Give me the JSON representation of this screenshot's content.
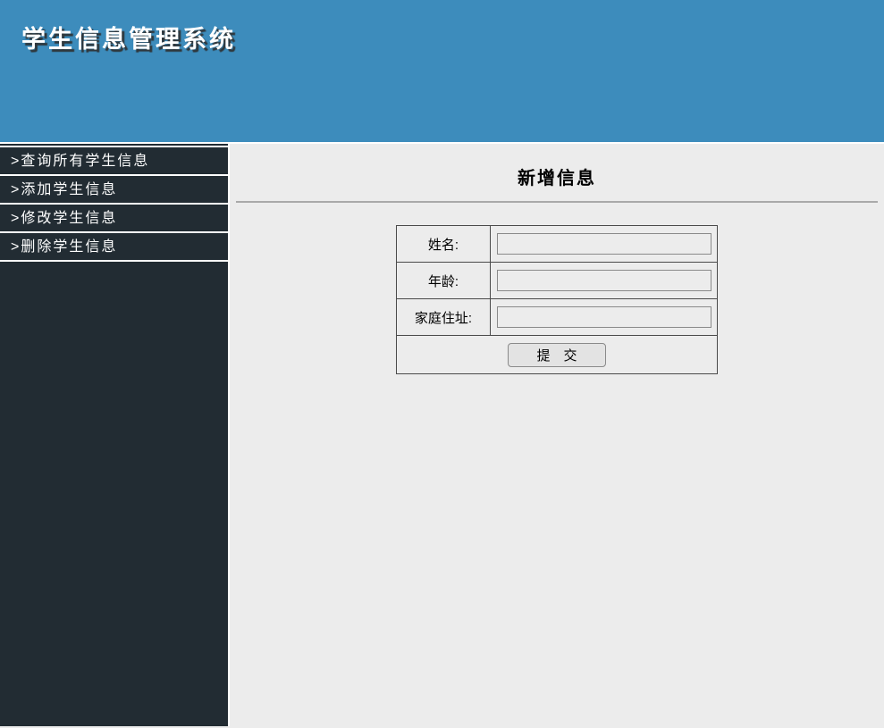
{
  "header": {
    "title": "学生信息管理系统"
  },
  "sidebar": {
    "items": [
      {
        "label": ">查询所有学生信息"
      },
      {
        "label": ">添加学生信息"
      },
      {
        "label": ">修改学生信息"
      },
      {
        "label": ">删除学生信息"
      }
    ]
  },
  "main": {
    "section_title": "新增信息",
    "form": {
      "fields": [
        {
          "label": "姓名:",
          "value": ""
        },
        {
          "label": "年龄:",
          "value": ""
        },
        {
          "label": "家庭住址:",
          "value": ""
        }
      ],
      "submit_label": "提　交"
    }
  },
  "colors": {
    "header_bg": "#3d8cbc",
    "sidebar_bg": "#222c33",
    "content_bg": "#ececec",
    "divider": "#a9a9a9",
    "table_border": "#4a4a4a",
    "input_border": "#8a8a8a",
    "button_bg": "#e3e3e3",
    "text_light": "#ffffff",
    "text_dark": "#000000"
  }
}
